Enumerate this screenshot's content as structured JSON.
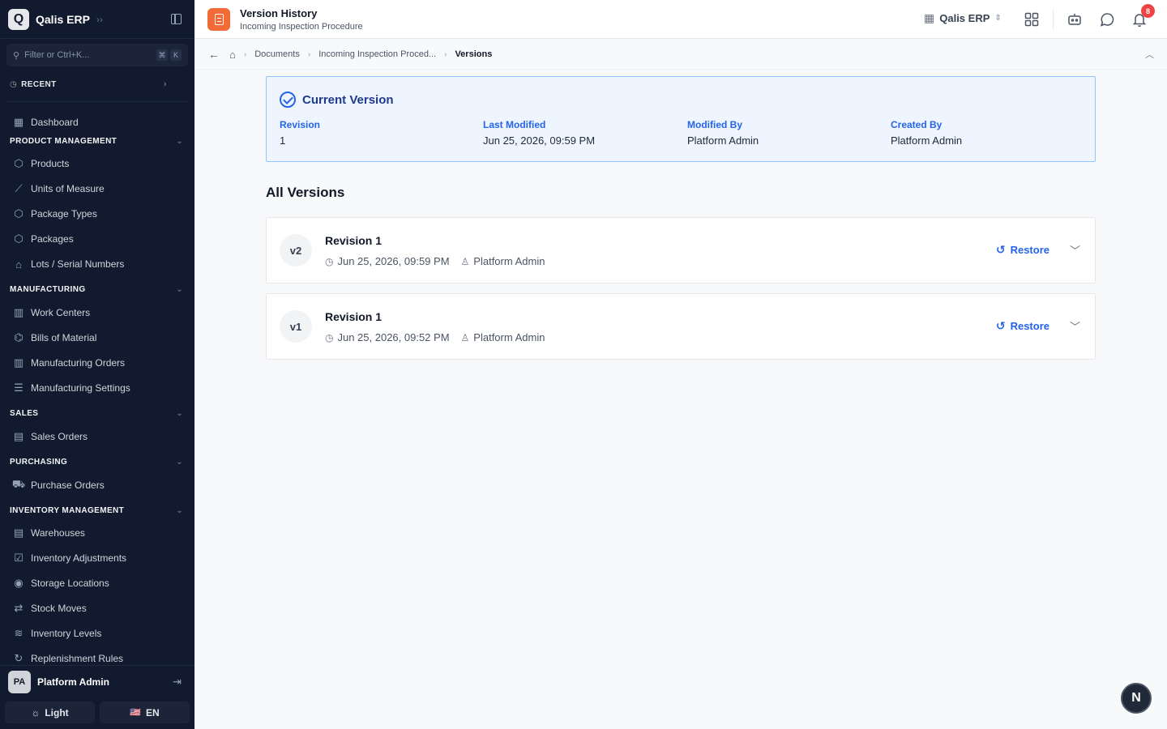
{
  "app": {
    "logo_letter": "Q",
    "name": "Qalis ERP"
  },
  "sidebar": {
    "filter_placeholder": "Filter or Ctrl+K...",
    "kbd": [
      "⌘",
      "K"
    ],
    "recent_label": "RECENT",
    "items": [
      {
        "type": "item",
        "label": "Dashboard",
        "icon": "dashboard-icon",
        "glyph": "▦"
      },
      {
        "type": "section",
        "label": "PRODUCT MANAGEMENT"
      },
      {
        "type": "item",
        "label": "Products",
        "icon": "box-icon",
        "glyph": "⬡"
      },
      {
        "type": "item",
        "label": "Units of Measure",
        "icon": "ruler-icon",
        "glyph": "⟋"
      },
      {
        "type": "item",
        "label": "Package Types",
        "icon": "package-icon",
        "glyph": "⬡"
      },
      {
        "type": "item",
        "label": "Packages",
        "icon": "package-icon",
        "glyph": "⬡"
      },
      {
        "type": "item",
        "label": "Lots / Serial Numbers",
        "icon": "tag-icon",
        "glyph": "⌂"
      },
      {
        "type": "section",
        "label": "MANUFACTURING"
      },
      {
        "type": "item",
        "label": "Work Centers",
        "icon": "factory-icon",
        "glyph": "▥"
      },
      {
        "type": "item",
        "label": "Bills of Material",
        "icon": "network-icon",
        "glyph": "⌬"
      },
      {
        "type": "item",
        "label": "Manufacturing Orders",
        "icon": "factory-icon",
        "glyph": "▥"
      },
      {
        "type": "item",
        "label": "Manufacturing Settings",
        "icon": "sliders-icon",
        "glyph": "☰"
      },
      {
        "type": "section",
        "label": "SALES"
      },
      {
        "type": "item",
        "label": "Sales Orders",
        "icon": "document-icon",
        "glyph": "▤"
      },
      {
        "type": "section",
        "label": "PURCHASING"
      },
      {
        "type": "item",
        "label": "Purchase Orders",
        "icon": "cart-icon",
        "glyph": "⛟"
      },
      {
        "type": "section",
        "label": "INVENTORY MANAGEMENT"
      },
      {
        "type": "item",
        "label": "Warehouses",
        "icon": "warehouse-icon",
        "glyph": "▤"
      },
      {
        "type": "item",
        "label": "Inventory Adjustments",
        "icon": "clipboard-icon",
        "glyph": "☑"
      },
      {
        "type": "item",
        "label": "Storage Locations",
        "icon": "map-pin-icon",
        "glyph": "◉"
      },
      {
        "type": "item",
        "label": "Stock Moves",
        "icon": "arrows-icon",
        "glyph": "⇄"
      },
      {
        "type": "item",
        "label": "Inventory Levels",
        "icon": "layers-icon",
        "glyph": "≋"
      },
      {
        "type": "item",
        "label": "Replenishment Rules",
        "icon": "refresh-icon",
        "glyph": "↻"
      }
    ],
    "user": {
      "initials": "PA",
      "name": "Platform Admin"
    },
    "theme_label": "Light",
    "language_label": "EN",
    "language_flag": "🇺🇸"
  },
  "header": {
    "title": "Version History",
    "subtitle": "Incoming Inspection Procedure",
    "org_name": "Qalis ERP",
    "notification_count": "8"
  },
  "breadcrumb": {
    "items": [
      "Documents",
      "Incoming Inspection Proced..."
    ],
    "current": "Versions"
  },
  "current_version": {
    "heading": "Current Version",
    "fields": [
      {
        "label": "Revision",
        "value": "1"
      },
      {
        "label": "Last Modified",
        "value": "Jun 25, 2026, 09:59 PM"
      },
      {
        "label": "Modified By",
        "value": "Platform Admin"
      },
      {
        "label": "Created By",
        "value": "Platform Admin"
      }
    ]
  },
  "all_versions": {
    "title": "All Versions",
    "restore_label": "Restore",
    "versions": [
      {
        "badge": "v2",
        "name": "Revision 1",
        "date": "Jun 25, 2026, 09:59 PM",
        "author": "Platform Admin"
      },
      {
        "badge": "v1",
        "name": "Revision 1",
        "date": "Jun 25, 2026, 09:52 PM",
        "author": "Platform Admin"
      }
    ]
  },
  "floating_button_label": "N",
  "colors": {
    "sidebar_bg": "#111a2e",
    "accent": "#2563eb",
    "doc_icon": "#f26a36",
    "badge": "#ef4444"
  }
}
